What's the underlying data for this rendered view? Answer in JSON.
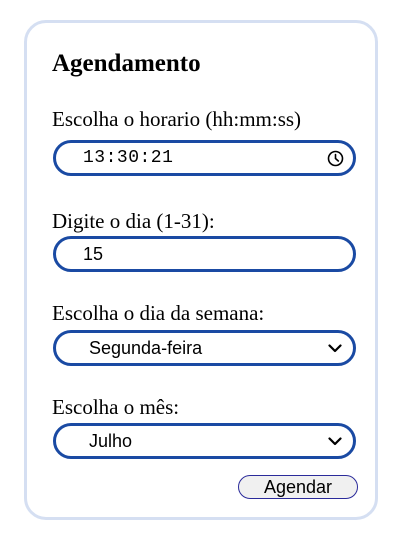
{
  "form": {
    "title": "Agendamento",
    "time_label": "Escolha o horario (hh:mm:ss)",
    "time_value": "13:30:21",
    "day_label": "Digite o dia (1-31):",
    "day_value": "15",
    "weekday_label": "Escolha o dia da semana:",
    "weekday_selected": "Segunda-feira",
    "month_label": "Escolha o mês:",
    "month_selected": "Julho",
    "submit_label": "Agendar"
  },
  "icons": {
    "time": "clock-icon",
    "dropdown": "chevron-down-icon"
  },
  "colors": {
    "field_border": "#1a4aa3",
    "card_border": "#d5dff2"
  }
}
